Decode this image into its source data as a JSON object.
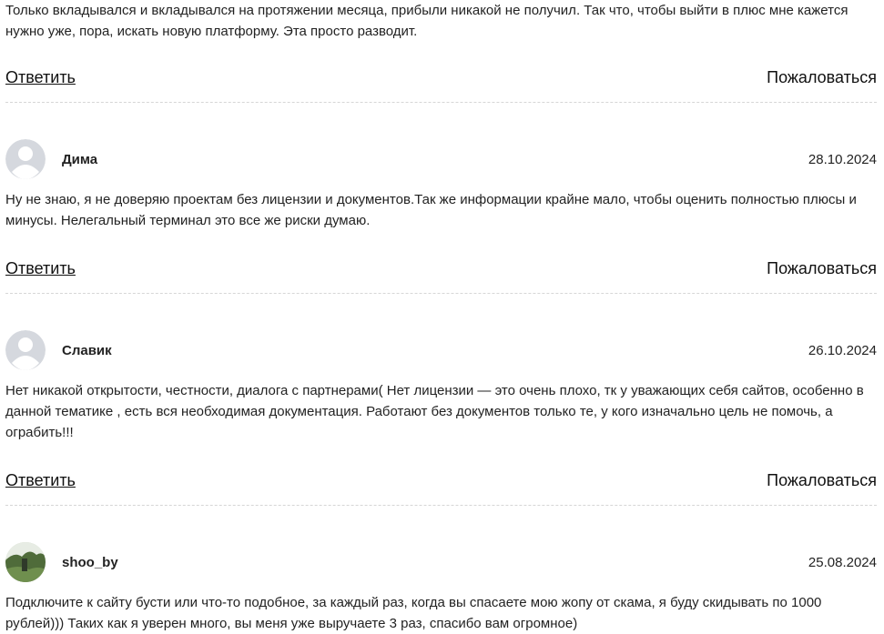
{
  "comments": [
    {
      "text": "Только вкладывался и вкладывался на протяжении месяца, прибыли никакой не получил. Так что, чтобы выйти в плюс мне кажется нужно уже, пора, искать новую платформу. Эта просто разводит.",
      "reply_label": "Ответить",
      "report_label": "Пожаловаться"
    },
    {
      "author": "Дима",
      "date": "28.10.2024",
      "avatar": "default-user-icon",
      "text": "Ну не знаю, я не доверяю проектам без лицензии и документов.Так же информации крайне мало, чтобы оценить полностью плюсы и минусы. Нелегальный терминал это все же риски думаю.",
      "reply_label": "Ответить",
      "report_label": "Пожаловаться"
    },
    {
      "author": "Славик",
      "date": "26.10.2024",
      "avatar": "default-user-icon",
      "text": "Нет никакой открытости, честности, диалога с партнерами( Нет лицензии — это очень плохо, тк у уважающих себя сайтов, особенно в данной тематике , есть вся необходимая документация. Работают без документов только те, у кого изначально цель не помочь, а ограбить!!!",
      "reply_label": "Ответить",
      "report_label": "Пожаловаться"
    },
    {
      "author": "shoo_by",
      "date": "25.08.2024",
      "avatar": "photo-avatar",
      "text": "Подключите к сайту бусти или что-то подобное, за каждый раз, когда вы спасаете мою жопу от скама, я буду скидывать по 1000 рублей))) Таких как я уверен много, вы меня уже выручаете 3 раз, спасибо вам огромное)"
    }
  ],
  "colors": {
    "text": "#222222",
    "link": "#111111",
    "divider": "#d6d6d6",
    "avatar_placeholder": "#d5d8de"
  }
}
